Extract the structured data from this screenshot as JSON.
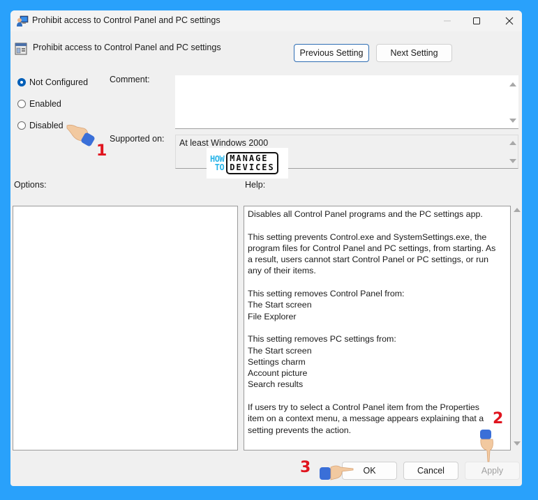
{
  "window": {
    "title": "Prohibit access to Control Panel and PC settings",
    "controls": {
      "minimize": "minimize",
      "maximize": "maximize",
      "close": "close"
    }
  },
  "header": {
    "title": "Prohibit access to Control Panel and PC settings",
    "previous_label": "Previous Setting",
    "next_label": "Next Setting"
  },
  "state": {
    "options": [
      {
        "label": "Not Configured",
        "checked": true
      },
      {
        "label": "Enabled",
        "checked": false
      },
      {
        "label": "Disabled",
        "checked": false
      }
    ]
  },
  "fields": {
    "comment_label": "Comment:",
    "comment_value": "",
    "supported_label": "Supported on:",
    "supported_value": "At least Windows 2000",
    "options_label": "Options:",
    "help_label": "Help:"
  },
  "help": {
    "paragraphs": [
      [
        "Disables all Control Panel programs and the PC settings app."
      ],
      [
        "This setting prevents Control.exe and SystemSettings.exe, the",
        "program files for Control Panel and PC settings, from starting. As",
        "a result, users cannot start Control Panel or PC settings, or run",
        "any of their items."
      ],
      [
        "This setting removes Control Panel from:",
        "The Start screen",
        "File Explorer"
      ],
      [
        "This setting removes PC settings from:",
        "The Start screen",
        "Settings charm",
        "Account picture",
        "Search results"
      ],
      [
        "If users try to select a Control Panel item from the Properties",
        "item on a context menu, a message appears explaining that a",
        "setting prevents the action."
      ]
    ]
  },
  "footer": {
    "ok_label": "OK",
    "cancel_label": "Cancel",
    "apply_label": "Apply",
    "apply_enabled": false
  },
  "watermark": {
    "how": "HOW",
    "to": "TO",
    "manage": "MANAGE",
    "devices": "DEVICES"
  },
  "annotations": {
    "step1": "1",
    "step2": "2",
    "step3": "3"
  },
  "colors": {
    "background": "#29a1fb",
    "accent": "#005fb8",
    "annotation": "#e0141e"
  }
}
